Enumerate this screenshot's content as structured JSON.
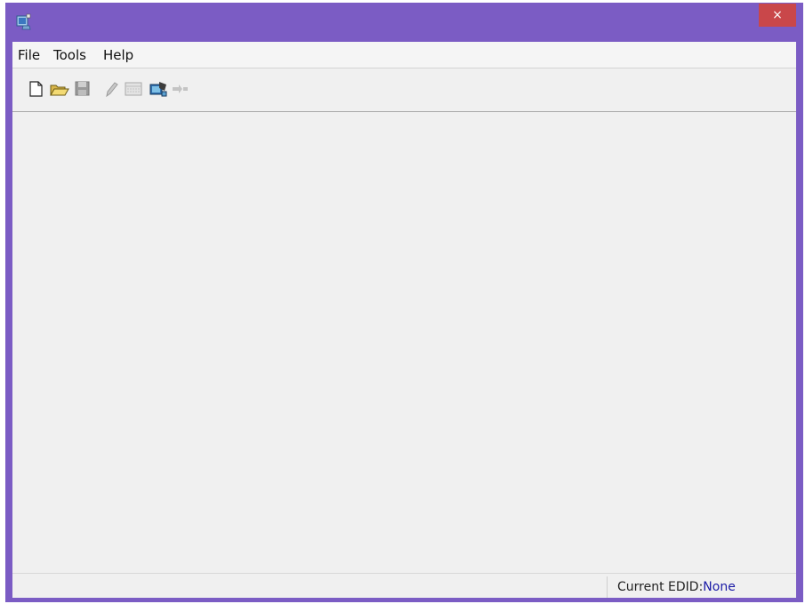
{
  "window": {
    "app_icon": "cube-computer-icon",
    "close_label": "×",
    "colors": {
      "frame": "#7b5cc4",
      "close": "#c9474a",
      "client": "#f0f0f0"
    }
  },
  "menubar": {
    "items": [
      {
        "label": "File"
      },
      {
        "label": "Tools"
      },
      {
        "label": "Help"
      }
    ]
  },
  "toolbar": {
    "buttons": [
      {
        "icon": "new-document-icon",
        "enabled": true
      },
      {
        "icon": "open-folder-icon",
        "enabled": true
      },
      {
        "icon": "save-icon",
        "enabled": false
      },
      {
        "icon": "edit-pencil-icon",
        "enabled": false
      },
      {
        "icon": "hex-grid-icon",
        "enabled": false
      },
      {
        "icon": "monitor-read-icon",
        "enabled": true
      },
      {
        "icon": "export-arrow-icon",
        "enabled": false
      }
    ]
  },
  "statusbar": {
    "label": "Current EDID:",
    "value": "None",
    "value_color": "#1a1aa6"
  }
}
